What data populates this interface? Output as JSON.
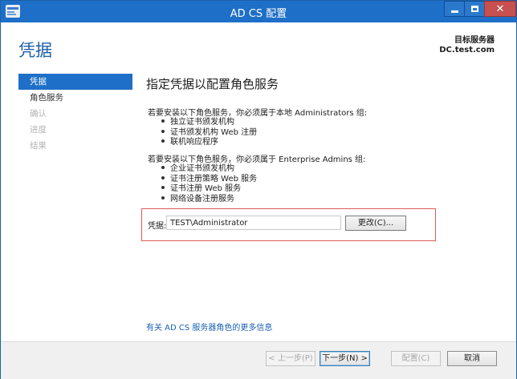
{
  "window": {
    "title": "AD CS 配置",
    "icon": "server-manager-icon",
    "controls": [
      "minimize-icon",
      "maximize-icon",
      "close-icon"
    ]
  },
  "header": {
    "page_title": "凭据",
    "target_label": "目标服务器",
    "target_value": "DC.test.com"
  },
  "nav": {
    "items": [
      {
        "label": "凭据",
        "state": "active"
      },
      {
        "label": "角色服务",
        "state": "normal"
      },
      {
        "label": "确认",
        "state": "disabled"
      },
      {
        "label": "进度",
        "state": "disabled"
      },
      {
        "label": "结果",
        "state": "disabled"
      }
    ]
  },
  "content": {
    "section_title": "指定凭据以配置角色服务",
    "local_admin_text": "若要安装以下角色服务，你必须属于本地 Administrators 组:",
    "local_admin_services": [
      "独立证书颁发机构",
      "证书颁发机构 Web 注册",
      "联机响应程序"
    ],
    "enterprise_admin_text": "若要安装以下角色服务，你必须属于 Enterprise Admins 组:",
    "enterprise_admin_services": [
      "企业证书颁发机构",
      "证书注册策略 Web 服务",
      "证书注册 Web 服务",
      "网络设备注册服务"
    ],
    "credentials_label": "凭据:",
    "credentials_value": "TEST\\Administrator",
    "change_button": "更改(C)...",
    "more_info_link": "有关 AD CS 服务器角色的更多信息"
  },
  "footer": {
    "prev_button": "< 上一步(P)",
    "next_button": "下一步(N) >",
    "configure_button": "配置(C)",
    "cancel_button": "取消"
  },
  "colors": {
    "accent": "#1e6fc7",
    "highlight_border": "#de5a5a",
    "link": "#1a5fb4"
  }
}
